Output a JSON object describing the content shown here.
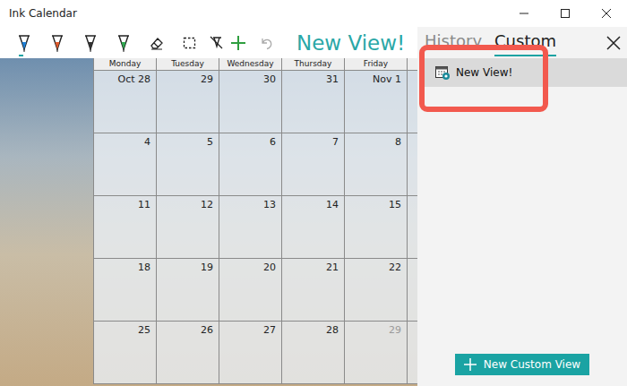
{
  "window": {
    "title": "Ink Calendar"
  },
  "toolbar": {
    "tools": [
      {
        "kind": "pen",
        "color": "#1e7fd6",
        "selected": true,
        "disabled": false
      },
      {
        "kind": "pen",
        "color": "#e0592a",
        "selected": false,
        "disabled": false
      },
      {
        "kind": "pen",
        "color": "#333333",
        "selected": false,
        "disabled": false
      },
      {
        "kind": "pen",
        "color": "#2fa84f",
        "selected": false,
        "disabled": false
      },
      {
        "kind": "eraser",
        "selected": false,
        "disabled": false
      },
      {
        "kind": "select",
        "selected": false,
        "disabled": false
      },
      {
        "kind": "touch",
        "selected": false,
        "disabled": false
      },
      {
        "kind": "add",
        "selected": false,
        "disabled": false
      },
      {
        "kind": "undo",
        "selected": false,
        "disabled": true
      }
    ],
    "view_title": "New View!"
  },
  "calendar": {
    "days": [
      "Monday",
      "Tuesday",
      "Wednesday",
      "Thursday",
      "Friday"
    ],
    "weeks": [
      [
        {
          "label": "Oct 28",
          "dimmed": false
        },
        {
          "label": "29",
          "dimmed": false
        },
        {
          "label": "30",
          "dimmed": false
        },
        {
          "label": "31",
          "dimmed": false
        },
        {
          "label": "Nov 1",
          "dimmed": false
        }
      ],
      [
        {
          "label": "4",
          "dimmed": false
        },
        {
          "label": "5",
          "dimmed": false
        },
        {
          "label": "6",
          "dimmed": false
        },
        {
          "label": "7",
          "dimmed": false
        },
        {
          "label": "8",
          "dimmed": false
        }
      ],
      [
        {
          "label": "11",
          "dimmed": false
        },
        {
          "label": "12",
          "dimmed": false
        },
        {
          "label": "13",
          "dimmed": false
        },
        {
          "label": "14",
          "dimmed": false
        },
        {
          "label": "15",
          "dimmed": false
        }
      ],
      [
        {
          "label": "18",
          "dimmed": false
        },
        {
          "label": "19",
          "dimmed": false
        },
        {
          "label": "20",
          "dimmed": false
        },
        {
          "label": "21",
          "dimmed": false
        },
        {
          "label": "22",
          "dimmed": false
        }
      ],
      [
        {
          "label": "25",
          "dimmed": false
        },
        {
          "label": "26",
          "dimmed": false
        },
        {
          "label": "27",
          "dimmed": false
        },
        {
          "label": "28",
          "dimmed": false
        },
        {
          "label": "29",
          "dimmed": true
        }
      ]
    ]
  },
  "panel": {
    "tabs": [
      {
        "label": "History",
        "selected": false
      },
      {
        "label": "Custom",
        "selected": true
      }
    ],
    "items": [
      {
        "label": "New View!",
        "selected": true,
        "annotated": true
      }
    ],
    "button": "New Custom View"
  }
}
